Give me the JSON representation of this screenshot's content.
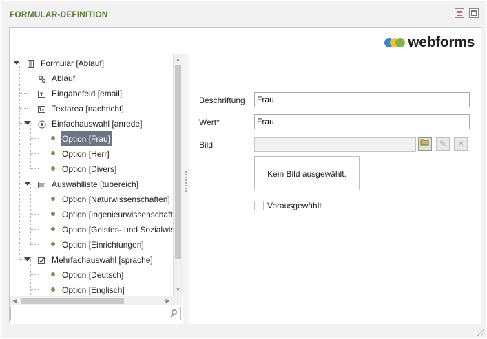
{
  "window": {
    "title": "FORMULAR-DEFINITION"
  },
  "logo": {
    "text": "webforms",
    "dot_colors": [
      "#2f7fc4",
      "#f1c232",
      "#7db043"
    ]
  },
  "tree": {
    "nodes": [
      {
        "label": "Formular [Ablauf]",
        "icon": "form-icon",
        "level": 0,
        "expanded": true
      },
      {
        "label": "Ablauf",
        "icon": "gears-icon",
        "level": 1
      },
      {
        "label": "Eingabefeld [email]",
        "icon": "textfield-icon",
        "level": 1
      },
      {
        "label": "Textarea [nachricht]",
        "icon": "textarea-icon",
        "level": 1
      },
      {
        "label": "Einfachauswahl [anrede]",
        "icon": "radio-icon",
        "level": 1,
        "expanded": true
      },
      {
        "label": "Option [Frau]",
        "icon": "option-dot-icon",
        "level": 2,
        "selected": true
      },
      {
        "label": "Option [Herr]",
        "icon": "option-dot-icon",
        "level": 2
      },
      {
        "label": "Option [Divers]",
        "icon": "option-dot-icon",
        "level": 2
      },
      {
        "label": "Auswahlliste [tubereich]",
        "icon": "list-icon",
        "level": 1,
        "expanded": true
      },
      {
        "label": "Option [Naturwissenschaften]",
        "icon": "option-dot-icon",
        "level": 2
      },
      {
        "label": "Option [Ingenieurwissenschaften]",
        "icon": "option-dot-icon",
        "level": 2
      },
      {
        "label": "Option [Geistes- und Sozialwissenschaften]",
        "icon": "option-dot-icon",
        "level": 2
      },
      {
        "label": "Option [Einrichtungen]",
        "icon": "option-dot-icon",
        "level": 2
      },
      {
        "label": "Mehrfachauswahl [sprache]",
        "icon": "checkbox-icon",
        "level": 1,
        "expanded": true
      },
      {
        "label": "Option [Deutsch]",
        "icon": "option-dot-icon",
        "level": 2
      },
      {
        "label": "Option [Englisch]",
        "icon": "option-dot-icon",
        "level": 2
      }
    ],
    "search_value": ""
  },
  "form": {
    "caption_label": "Beschriftung",
    "caption_value": "Frau",
    "value_label": "Wert*",
    "value_value": "Frau",
    "image_label": "Bild",
    "image_value": "",
    "no_image_text": "Kein Bild ausgewählt.",
    "preselected_label": "Vorausgewählt",
    "preselected_checked": false
  }
}
